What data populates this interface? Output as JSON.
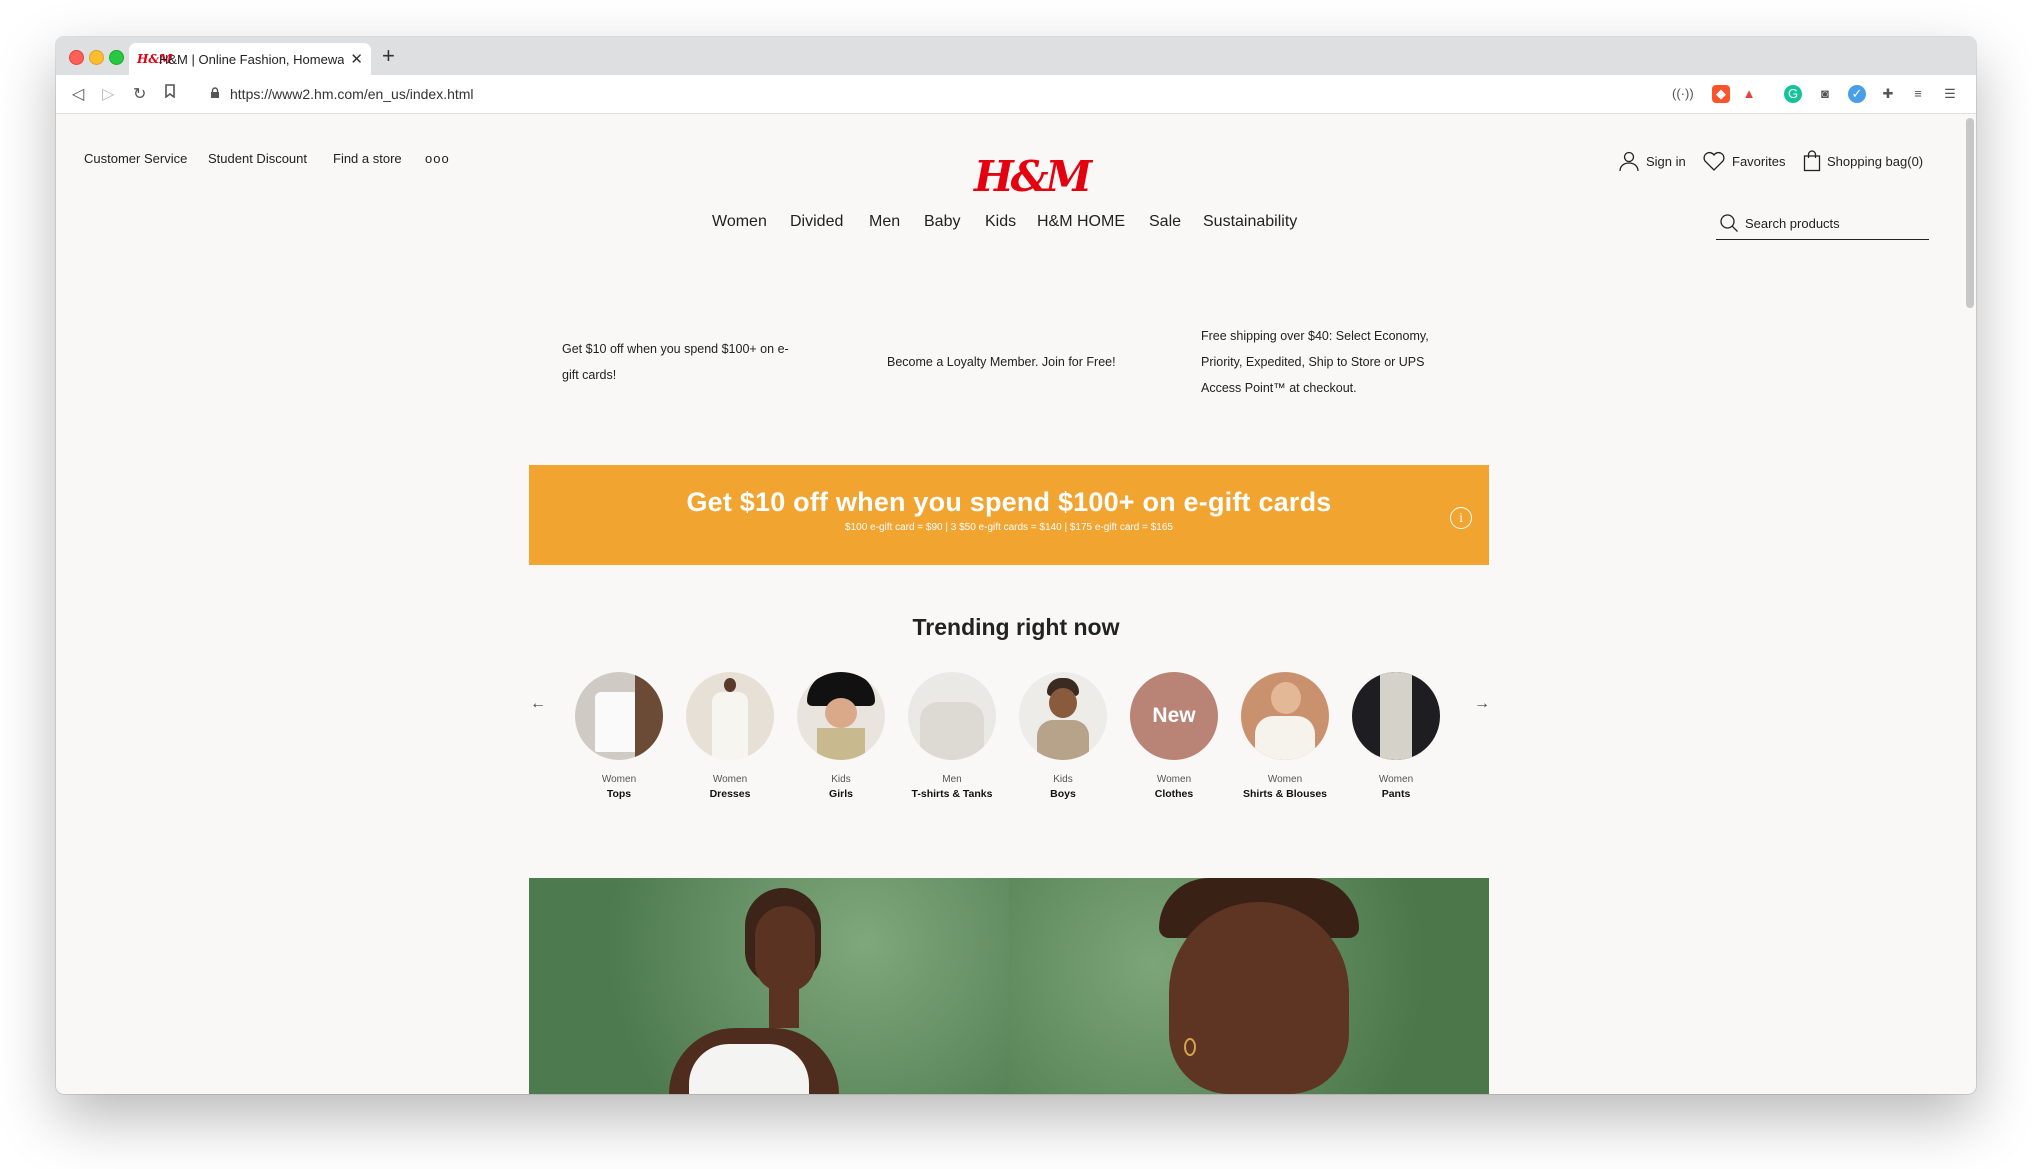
{
  "browser": {
    "tab_title": "H&M | Online Fashion, Homewa",
    "tab_favicon": "H&M",
    "url": "https://www2.hm.com/en_us/index.html"
  },
  "header": {
    "utility_links": [
      "Customer Service",
      "Student Discount",
      "Find a store"
    ],
    "more_icon": "ooo",
    "logo_text": "H&M",
    "sign_in": "Sign in",
    "favorites": "Favorites",
    "shopping_bag": "Shopping bag(0)"
  },
  "nav": {
    "items": [
      "Women",
      "Divided",
      "Men",
      "Baby",
      "Kids",
      "H&M HOME",
      "Sale",
      "Sustainability"
    ],
    "search_placeholder": "Search products"
  },
  "promos": [
    "Get $10 off when you spend $100+ on e-gift cards!",
    "Become a Loyalty Member. Join for Free!",
    "Free shipping over $40: Select Economy, Priority, Expedited, Ship to Store or UPS Access Point™ at checkout."
  ],
  "banner": {
    "title": "Get $10 off when you spend $100+ on e-gift cards",
    "subtitle": "$100 e-gift card = $90 | 3 $50 e-gift cards = $140 | $175 e-gift card = $165",
    "info_icon": "i",
    "color": "#f2a431"
  },
  "trending": {
    "title": "Trending right now",
    "categories": [
      {
        "group": "Women",
        "name": "Tops"
      },
      {
        "group": "Women",
        "name": "Dresses"
      },
      {
        "group": "Kids",
        "name": "Girls"
      },
      {
        "group": "Men",
        "name": "T-shirts & Tanks"
      },
      {
        "group": "Kids",
        "name": "Boys"
      },
      {
        "group": "Women",
        "name": "Clothes",
        "badge": "New"
      },
      {
        "group": "Women",
        "name": "Shirts & Blouses"
      },
      {
        "group": "Women",
        "name": "Pants"
      }
    ]
  },
  "colors": {
    "brand_red": "#e50010",
    "hero_green": "#5f8e5f"
  }
}
